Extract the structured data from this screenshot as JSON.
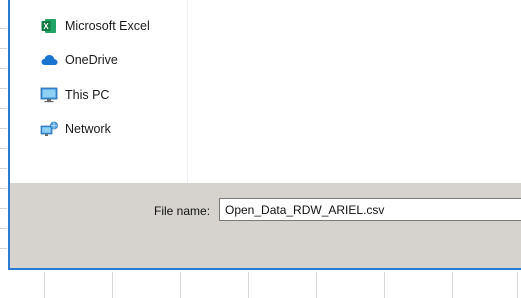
{
  "nav": {
    "items": [
      {
        "label": "Microsoft Excel",
        "icon": "excel-icon"
      },
      {
        "label": "OneDrive",
        "icon": "onedrive-icon"
      },
      {
        "label": "This PC",
        "icon": "this-pc-icon"
      },
      {
        "label": "Network",
        "icon": "network-icon"
      }
    ]
  },
  "save": {
    "filename_label": "File name:",
    "filename_value": "Open_Data_RDW_ARIEL.csv"
  },
  "colors": {
    "accent_border": "#2b7bd3",
    "excel_green": "#1d6f42",
    "onedrive_blue": "#1a73d0",
    "bottom_bar": "#d6d3ce"
  }
}
